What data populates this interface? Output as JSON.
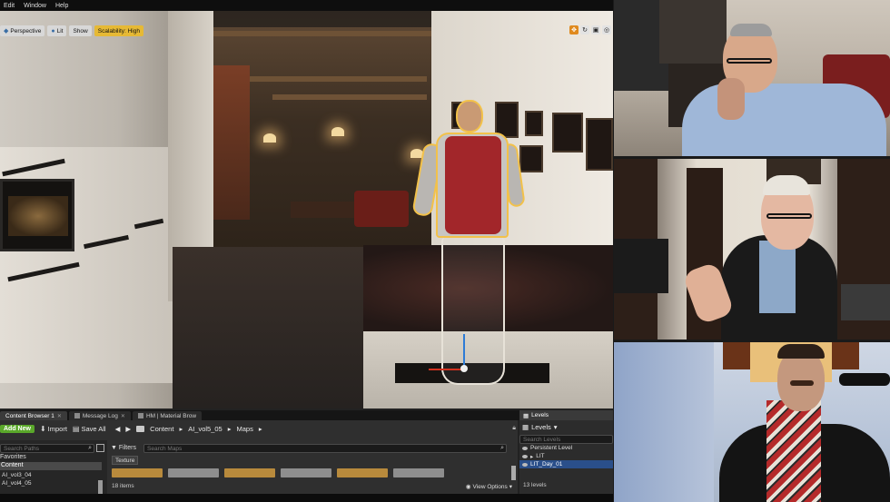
{
  "menu": {
    "items": [
      "Edit",
      "Window",
      "Help"
    ]
  },
  "viewport": {
    "buttons": {
      "perspective": "Perspective",
      "lit": "Lit",
      "show": "Show",
      "scalability": "Scalability: High"
    }
  },
  "tabs": [
    {
      "label": "Content Browser 1"
    },
    {
      "label": "Message Log"
    },
    {
      "label": "HM | Material Brow"
    }
  ],
  "content_browser": {
    "add_new": "Add New",
    "import": "Import",
    "save_all": "Save All",
    "breadcrumbs": [
      "Content",
      "AI_vol5_05",
      "Maps"
    ],
    "search_paths_placeholder": "Search Paths",
    "favorites": "Favorites",
    "content": "Content",
    "maps": [
      "AI_vol3_04",
      "AI_vol4_05"
    ],
    "filters": "Filters",
    "search_maps_placeholder": "Search Maps",
    "filter_chip": "Texture",
    "item_count": "18 items",
    "view_options": "View Options",
    "thumb_colors": [
      "#b88a3c",
      "#8e8e8e",
      "#b88a3c",
      "#8e8e8e",
      "#b88a3c",
      "#8e8e8e"
    ]
  },
  "levels": {
    "tab": "Levels",
    "header": "Levels",
    "search_placeholder": "Search Levels",
    "rows": [
      "Persistent Level",
      "LIT",
      "LIT_Day_01"
    ],
    "count": "13 levels"
  },
  "colors": {
    "accent": "#e6b935",
    "add_new": "#5aa82a",
    "selection": "#2a4f8a",
    "outline": "#f2c14a"
  }
}
